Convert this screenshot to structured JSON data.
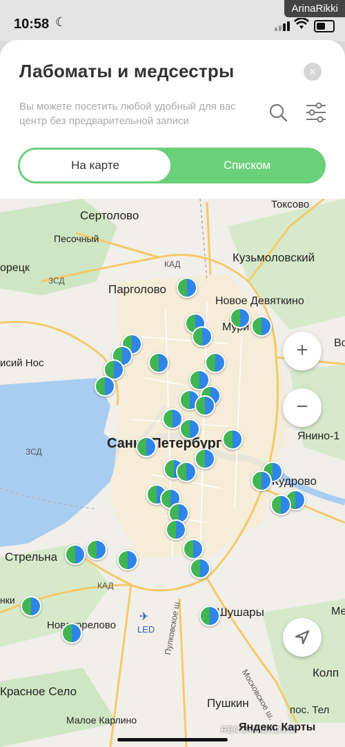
{
  "status": {
    "time": "10:58",
    "watermark": "ArinaRikki"
  },
  "header": {
    "title": "Лабоматы и медсестры",
    "subtitle": "Вы можете посетить любой удобный для вас центр без предварительной записи",
    "close_icon": "×"
  },
  "view_toggle": {
    "map_label": "На карте",
    "list_label": "Списком",
    "active": "map"
  },
  "map": {
    "labels": {
      "toksovo": "Токсово",
      "sertolovo": "Сертолово",
      "pesochny": "Песочный",
      "kuzmolovsky": "Кузьмоловский",
      "pargolovo": "Парголово",
      "novoe_devyatkino": "Новое Девяткино",
      "murino": "Мури",
      "spb": "Санкт-Петербург",
      "yanino": "Янино-1",
      "kudrovo": "Кудрово",
      "strelna": "Стрельна",
      "shushary": "Шушары",
      "novoe_koirovo": "Новокорелово",
      "krasnoe_selo": "Красное Село",
      "pushkin": "Пушкин",
      "kolpino": "Колп",
      "pos_tel": "пос. Тел",
      "maloe_karlino": "Малое Карлино",
      "led": "LED",
      "kad1": "КАД",
      "kad2": "КАД",
      "zsd1": "ЗСД",
      "zsd2": "ЗСД",
      "moskovskoe": "Московское ш.",
      "pulkovskoe": "Пулковское ш.",
      "recek": "орецк",
      "lisiy_nos": "исий Нос",
      "nki": "нки",
      "me": "Ме",
      "vo": "Во"
    },
    "zoom_in": "+",
    "zoom_out": "−",
    "attribution": "Яндекс Карты",
    "recommend": "RECOMMEND.RU"
  }
}
